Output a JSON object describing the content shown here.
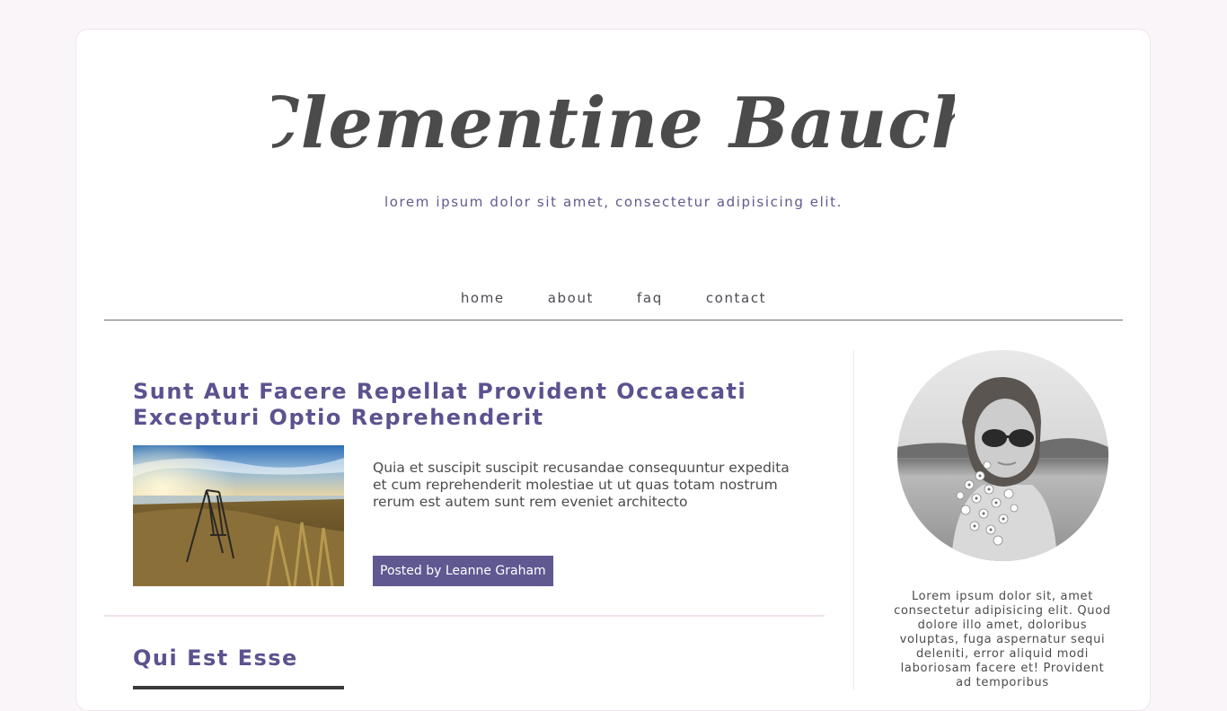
{
  "header": {
    "site_title": "Clementine Bauch",
    "tagline": "lorem ipsum dolor sit amet, consectetur adipisicing elit."
  },
  "nav": {
    "items": [
      "home",
      "about",
      "faq",
      "contact"
    ]
  },
  "posts": [
    {
      "title": "Sunt Aut Facere Repellat Provident Occaecati Excepturi Optio Reprehenderit",
      "excerpt": "Quia et suscipit suscipit recusandae consequuntur expedita et cum reprehenderit molestiae ut ut quas totam nostrum rerum est autem sunt rem eveniet architecto",
      "author_label": "Posted by Leanne Graham"
    },
    {
      "title": "Qui Est Esse"
    }
  ],
  "sidebar": {
    "bio": "Lorem ipsum dolor sit, amet consectetur adipisicing elit. Quod dolore illo amet, doloribus voluptas, fuga aspernatur sequi deleniti, error aliquid modi laboriosam facere et! Provident ad temporibus"
  },
  "colors": {
    "page_background": "#f9f5f8",
    "card_background": "#ffffff",
    "accent_purple": "#5f5891",
    "title_gray": "#4b4b4b",
    "divider_pink": "#f1e1ee"
  }
}
